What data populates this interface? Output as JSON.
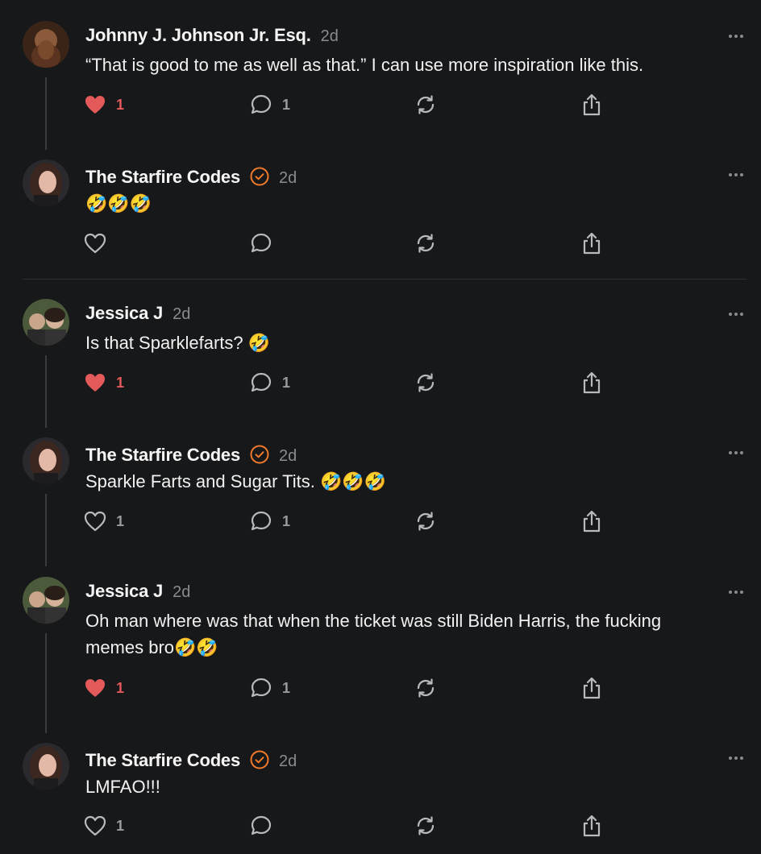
{
  "colors": {
    "background": "#17181a",
    "like_active": "#e45a5a",
    "verified": "#f07a2a",
    "muted": "#8a8b8e"
  },
  "posts": [
    {
      "author": "Johnny J. Johnson Jr. Esq.",
      "verified": false,
      "time": "2d",
      "text": "“That is good to me as well as that.” I can use more inspiration like this.",
      "likes": "1",
      "liked": true,
      "comments": "1"
    },
    {
      "author": "The Starfire Codes",
      "verified": true,
      "time": "2d",
      "text": "🤣🤣🤣",
      "likes": "",
      "liked": false,
      "comments": ""
    },
    {
      "author": "Jessica J",
      "verified": false,
      "time": "2d",
      "text": "Is that Sparklefarts? 🤣",
      "likes": "1",
      "liked": true,
      "comments": "1"
    },
    {
      "author": "The Starfire Codes",
      "verified": true,
      "time": "2d",
      "text": "Sparkle Farts and Sugar Tits. 🤣🤣🤣",
      "likes": "1",
      "liked": false,
      "comments": "1"
    },
    {
      "author": "Jessica J",
      "verified": false,
      "time": "2d",
      "text": "Oh man where was that when the ticket was still Biden Harris, the fucking memes bro🤣🤣",
      "likes": "1",
      "liked": true,
      "comments": "1"
    },
    {
      "author": "The Starfire Codes",
      "verified": true,
      "time": "2d",
      "text": "LMFAO!!!",
      "likes": "1",
      "liked": false,
      "comments": ""
    }
  ],
  "icons": {
    "like": "heart-icon",
    "comment": "comment-bubble-icon",
    "repost": "repost-icon",
    "share": "share-icon",
    "more": "more-options-icon",
    "verified": "verified-badge-icon"
  }
}
